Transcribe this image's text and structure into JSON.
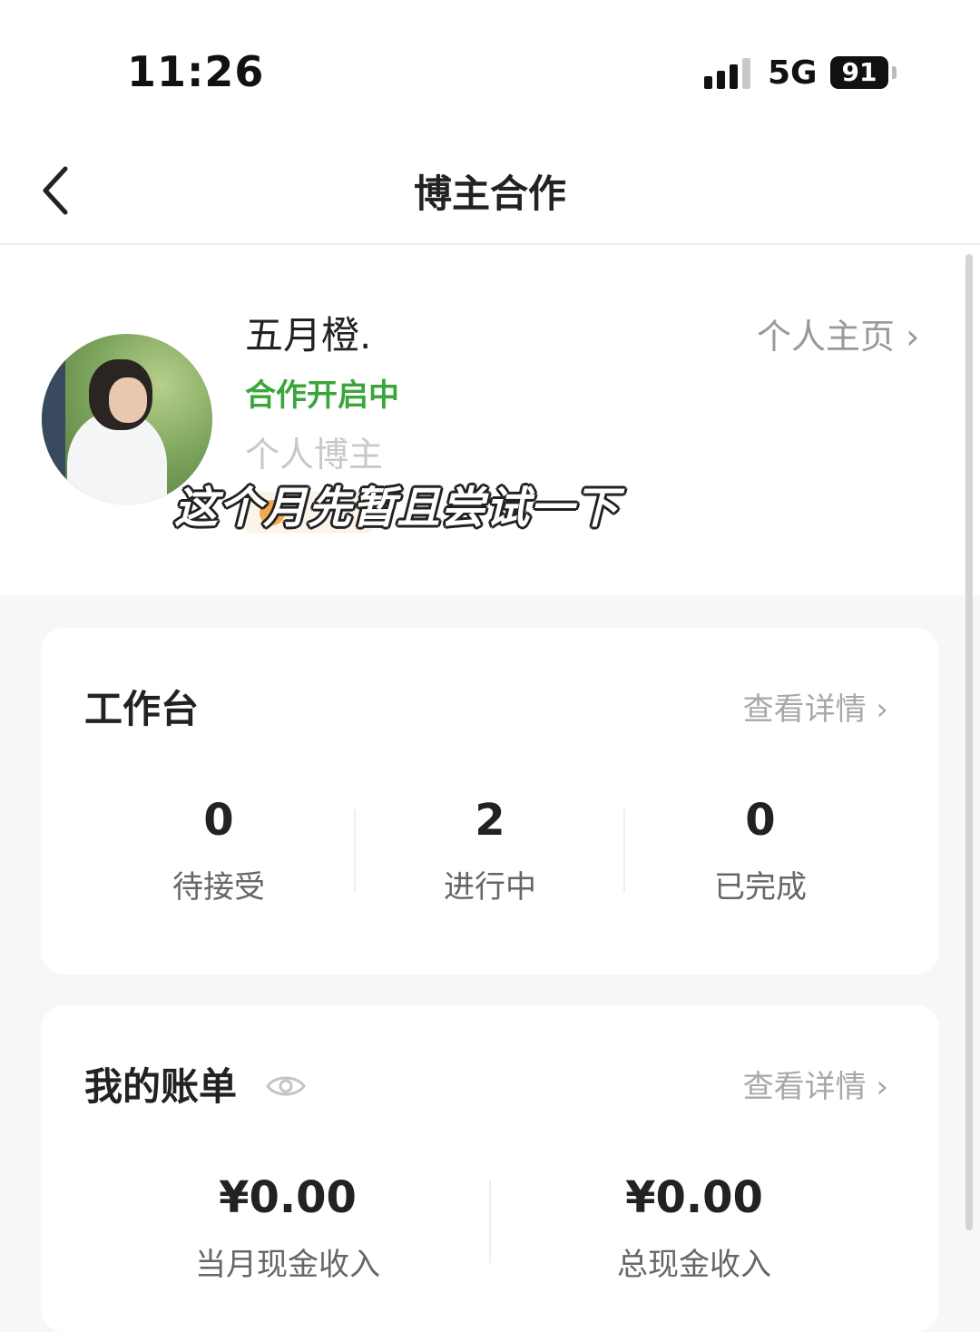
{
  "status_bar": {
    "time": "11:26",
    "network": "5G",
    "battery": "91"
  },
  "nav": {
    "title": "博主合作",
    "back_icon": "chevron-left-icon"
  },
  "profile": {
    "name": "五月橙.",
    "homepage_link": "个人主页 ›",
    "status": "合作开启中",
    "status_color": "#3aa63a",
    "type": "个人博主"
  },
  "caption": "这个月先暂且尝试一下",
  "workbench": {
    "title": "工作台",
    "detail_link": "查看详情 ›",
    "stats": [
      {
        "value": "0",
        "label": "待接受"
      },
      {
        "value": "2",
        "label": "进行中"
      },
      {
        "value": "0",
        "label": "已完成"
      }
    ]
  },
  "bill": {
    "title": "我的账单",
    "eye_icon": "eye-icon",
    "detail_link": "查看详情 ›",
    "stats": [
      {
        "value": "¥0.00",
        "label": "当月现金收入"
      },
      {
        "value": "¥0.00",
        "label": "总现金收入"
      }
    ]
  }
}
